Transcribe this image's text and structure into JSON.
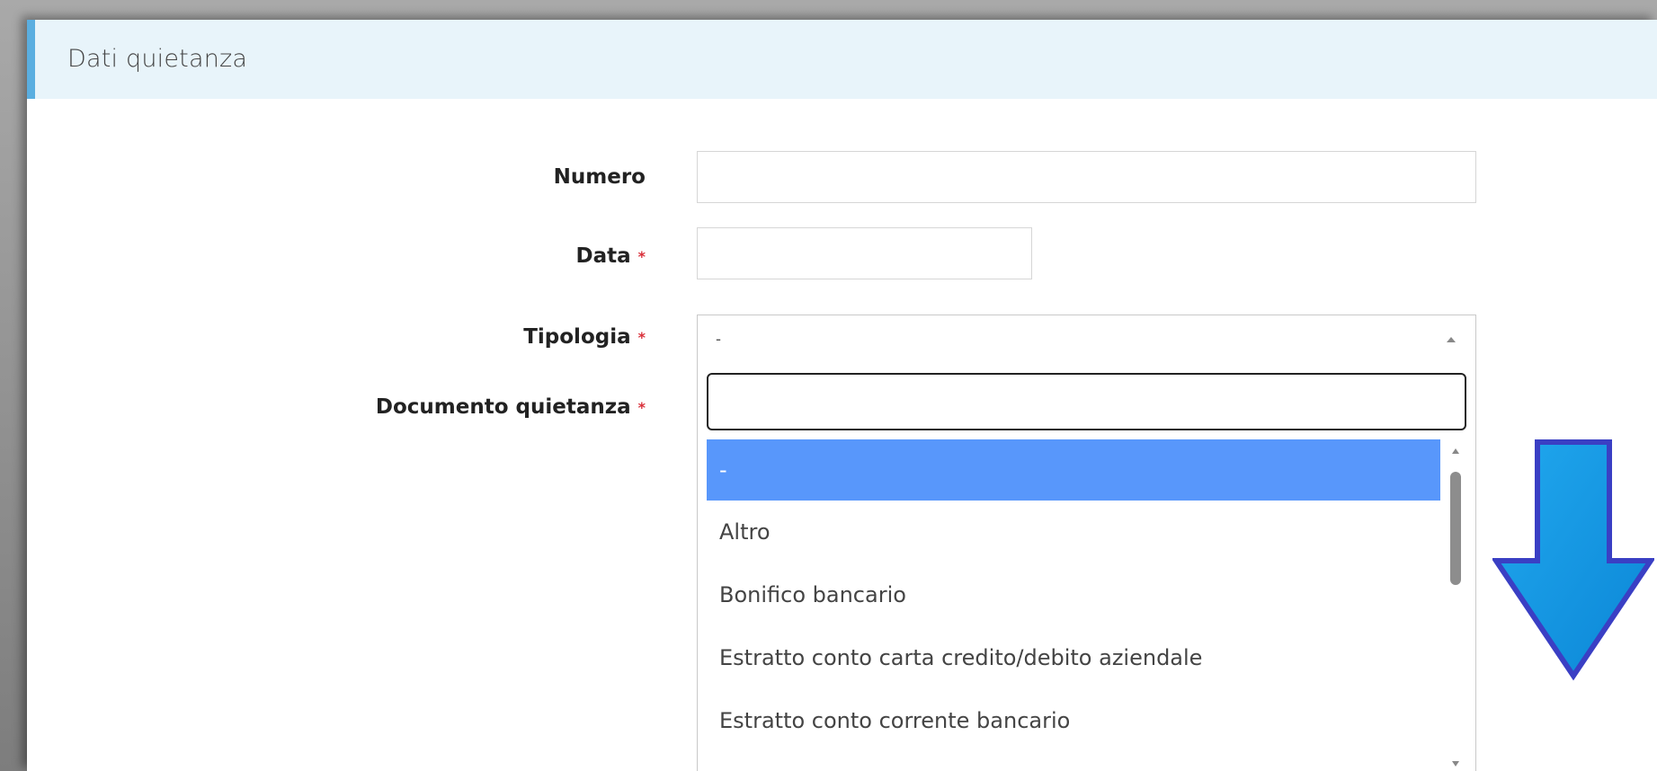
{
  "panel": {
    "title": "Dati quietanza"
  },
  "form": {
    "numero_label": "Numero",
    "data_label": "Data",
    "tipologia_label": "Tipologia",
    "documento_label": "Documento quietanza",
    "required_mark": "*",
    "numero_value": "",
    "data_value": "",
    "tipologia_selected": "-"
  },
  "dropdown": {
    "search_value": "",
    "options": [
      "-",
      "Altro",
      "Bonifico bancario",
      "Estratto conto carta credito/debito aziendale",
      "Estratto conto corrente bancario"
    ],
    "selected_index": 0
  },
  "colors": {
    "header_bg": "#e8f4fa",
    "header_accent": "#5aaee0",
    "selected_option_bg": "#5897fb",
    "required": "#d9303a",
    "arrow_fill": "#1a9be0",
    "arrow_stroke": "#3a3fc4"
  },
  "icons": {
    "select_caret": "caret-up-icon",
    "annotation": "down-arrow-icon"
  }
}
